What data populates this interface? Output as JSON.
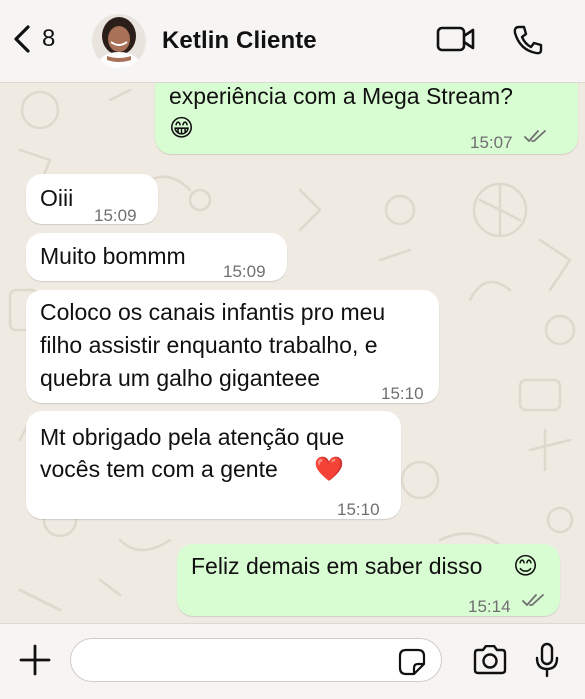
{
  "header": {
    "back_count": "8",
    "contact_name": "Ketlin Cliente"
  },
  "messages": [
    {
      "direction": "outgoing",
      "text": "experiência com a Mega Stream?",
      "emoji": "😁",
      "time": "15:07",
      "status": "read"
    },
    {
      "direction": "incoming",
      "text": "Oiii",
      "time": "15:09"
    },
    {
      "direction": "incoming",
      "text": "Muito bommm",
      "time": "15:09"
    },
    {
      "direction": "incoming",
      "lines": [
        "Coloco os canais infantis pro meu",
        "filho assistir enquanto trabalho, e",
        "quebra um galho giganteee"
      ],
      "time": "15:10"
    },
    {
      "direction": "incoming",
      "lines": [
        "Mt obrigado pela atenção que",
        "vocês tem com a gente"
      ],
      "emoji": "❤️",
      "time": "15:10"
    },
    {
      "direction": "outgoing",
      "text": "Feliz demais em saber disso",
      "emoji": "😊",
      "time": "15:14",
      "status": "read"
    }
  ],
  "input": {
    "value": "",
    "placeholder": ""
  },
  "colors": {
    "incoming_bubble": "#ffffff",
    "outgoing_bubble": "#d9fdd3",
    "read_ticks": "#707070",
    "background": "#efeae2"
  }
}
